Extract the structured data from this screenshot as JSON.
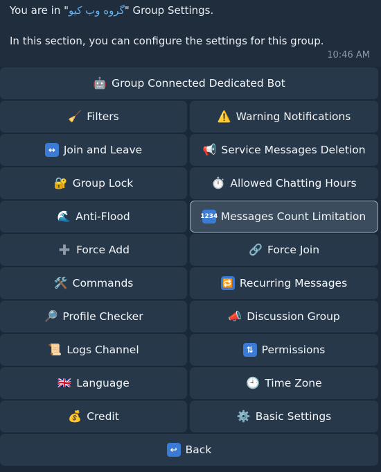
{
  "message": {
    "line1_prefix": "You are in \"",
    "group_name": "گروه وب کیو",
    "line1_suffix": "\" Group Settings.",
    "line2": "In this section, you can configure the settings for this group.",
    "time": "10:46 AM"
  },
  "buttons": {
    "dedicated_bot": "Group Connected Dedicated Bot",
    "filters": "Filters",
    "warning_notifications": "Warning Notifications",
    "join_and_leave": "Join and Leave",
    "service_messages_deletion": "Service Messages Deletion",
    "group_lock": "Group Lock",
    "allowed_chatting_hours": "Allowed Chatting Hours",
    "anti_flood": "Anti-Flood",
    "messages_count_limitation": "Messages Count Limitation",
    "force_add": "Force Add",
    "force_join": "Force Join",
    "commands": "Commands",
    "recurring_messages": "Recurring Messages",
    "profile_checker": "Profile Checker",
    "discussion_group": "Discussion Group",
    "logs_channel": "Logs Channel",
    "permissions": "Permissions",
    "language": "Language",
    "time_zone": "Time Zone",
    "credit": "Credit",
    "basic_settings": "Basic Settings",
    "back": "Back"
  },
  "icons": {
    "dedicated_bot": "robot-icon",
    "filters": "broom-icon",
    "warning_notifications": "warning-icon",
    "join_and_leave": "left-right-arrow-icon",
    "service_messages_deletion": "megaphone-icon",
    "group_lock": "lock-with-key-icon",
    "allowed_chatting_hours": "stopwatch-icon",
    "anti_flood": "wave-icon",
    "messages_count_limitation": "numbers-input-icon",
    "force_add": "plus-icon",
    "force_join": "link-icon",
    "commands": "tools-icon",
    "recurring_messages": "repeat-icon",
    "profile_checker": "magnifier-icon",
    "discussion_group": "megaphone-icon",
    "logs_channel": "scroll-icon",
    "permissions": "sort-icon",
    "language": "uk-flag-icon",
    "time_zone": "clock-icon",
    "credit": "money-bag-icon",
    "basic_settings": "gear-icon",
    "back": "return-arrow-icon"
  },
  "selected_button": "messages_count_limitation",
  "colors": {
    "background": "#1b2838",
    "button": "#26384a",
    "button_selected": "#3a4c5e",
    "group_name": "#62b0f0"
  }
}
